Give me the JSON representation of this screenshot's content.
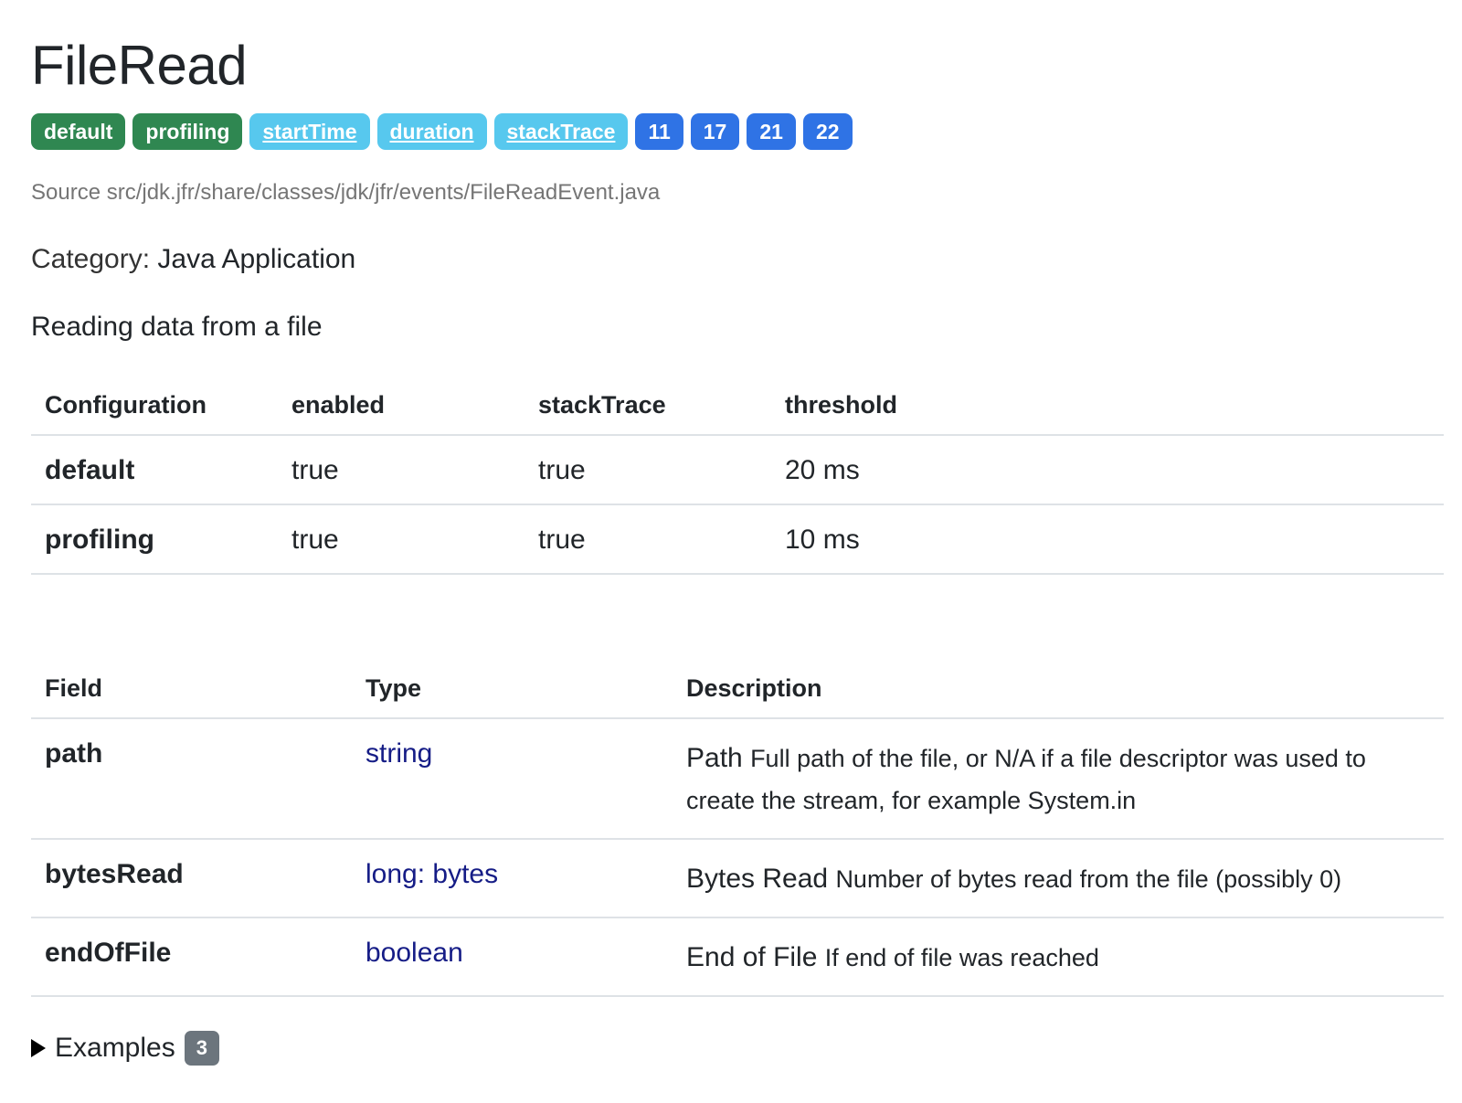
{
  "title": "FileRead",
  "badges": [
    {
      "label": "default",
      "style": "green"
    },
    {
      "label": "profiling",
      "style": "green"
    },
    {
      "label": "startTime",
      "style": "cyan"
    },
    {
      "label": "duration",
      "style": "cyan"
    },
    {
      "label": "stackTrace",
      "style": "cyan"
    },
    {
      "label": "11",
      "style": "blue"
    },
    {
      "label": "17",
      "style": "blue"
    },
    {
      "label": "21",
      "style": "blue"
    },
    {
      "label": "22",
      "style": "blue"
    }
  ],
  "source": "Source src/jdk.jfr/share/classes/jdk/jfr/events/FileReadEvent.java",
  "category": {
    "label": "Category:",
    "value": "Java Application"
  },
  "description": "Reading data from a file",
  "config_table": {
    "headers": [
      "Configuration",
      "enabled",
      "stackTrace",
      "threshold"
    ],
    "rows": [
      [
        "default",
        "true",
        "true",
        "20 ms"
      ],
      [
        "profiling",
        "true",
        "true",
        "10 ms"
      ]
    ]
  },
  "fields_table": {
    "headers": [
      "Field",
      "Type",
      "Description"
    ],
    "rows": [
      {
        "field": "path",
        "type": "string",
        "label": "Path",
        "text": "Full path of the file, or N/A if a file descriptor was used to create the stream, for example System.in"
      },
      {
        "field": "bytesRead",
        "type": "long: bytes",
        "label": "Bytes Read",
        "text": "Number of bytes read from the file (possibly 0)"
      },
      {
        "field": "endOfFile",
        "type": "boolean",
        "label": "End of File",
        "text": "If end of file was reached"
      }
    ]
  },
  "examples": {
    "label": "Examples",
    "count": "3"
  },
  "colors": {
    "badge_green": "#2f8751",
    "badge_cyan": "#57c8ee",
    "badge_blue": "#2f73e5",
    "type_link": "#151c86",
    "count_badge": "#6c757d"
  }
}
